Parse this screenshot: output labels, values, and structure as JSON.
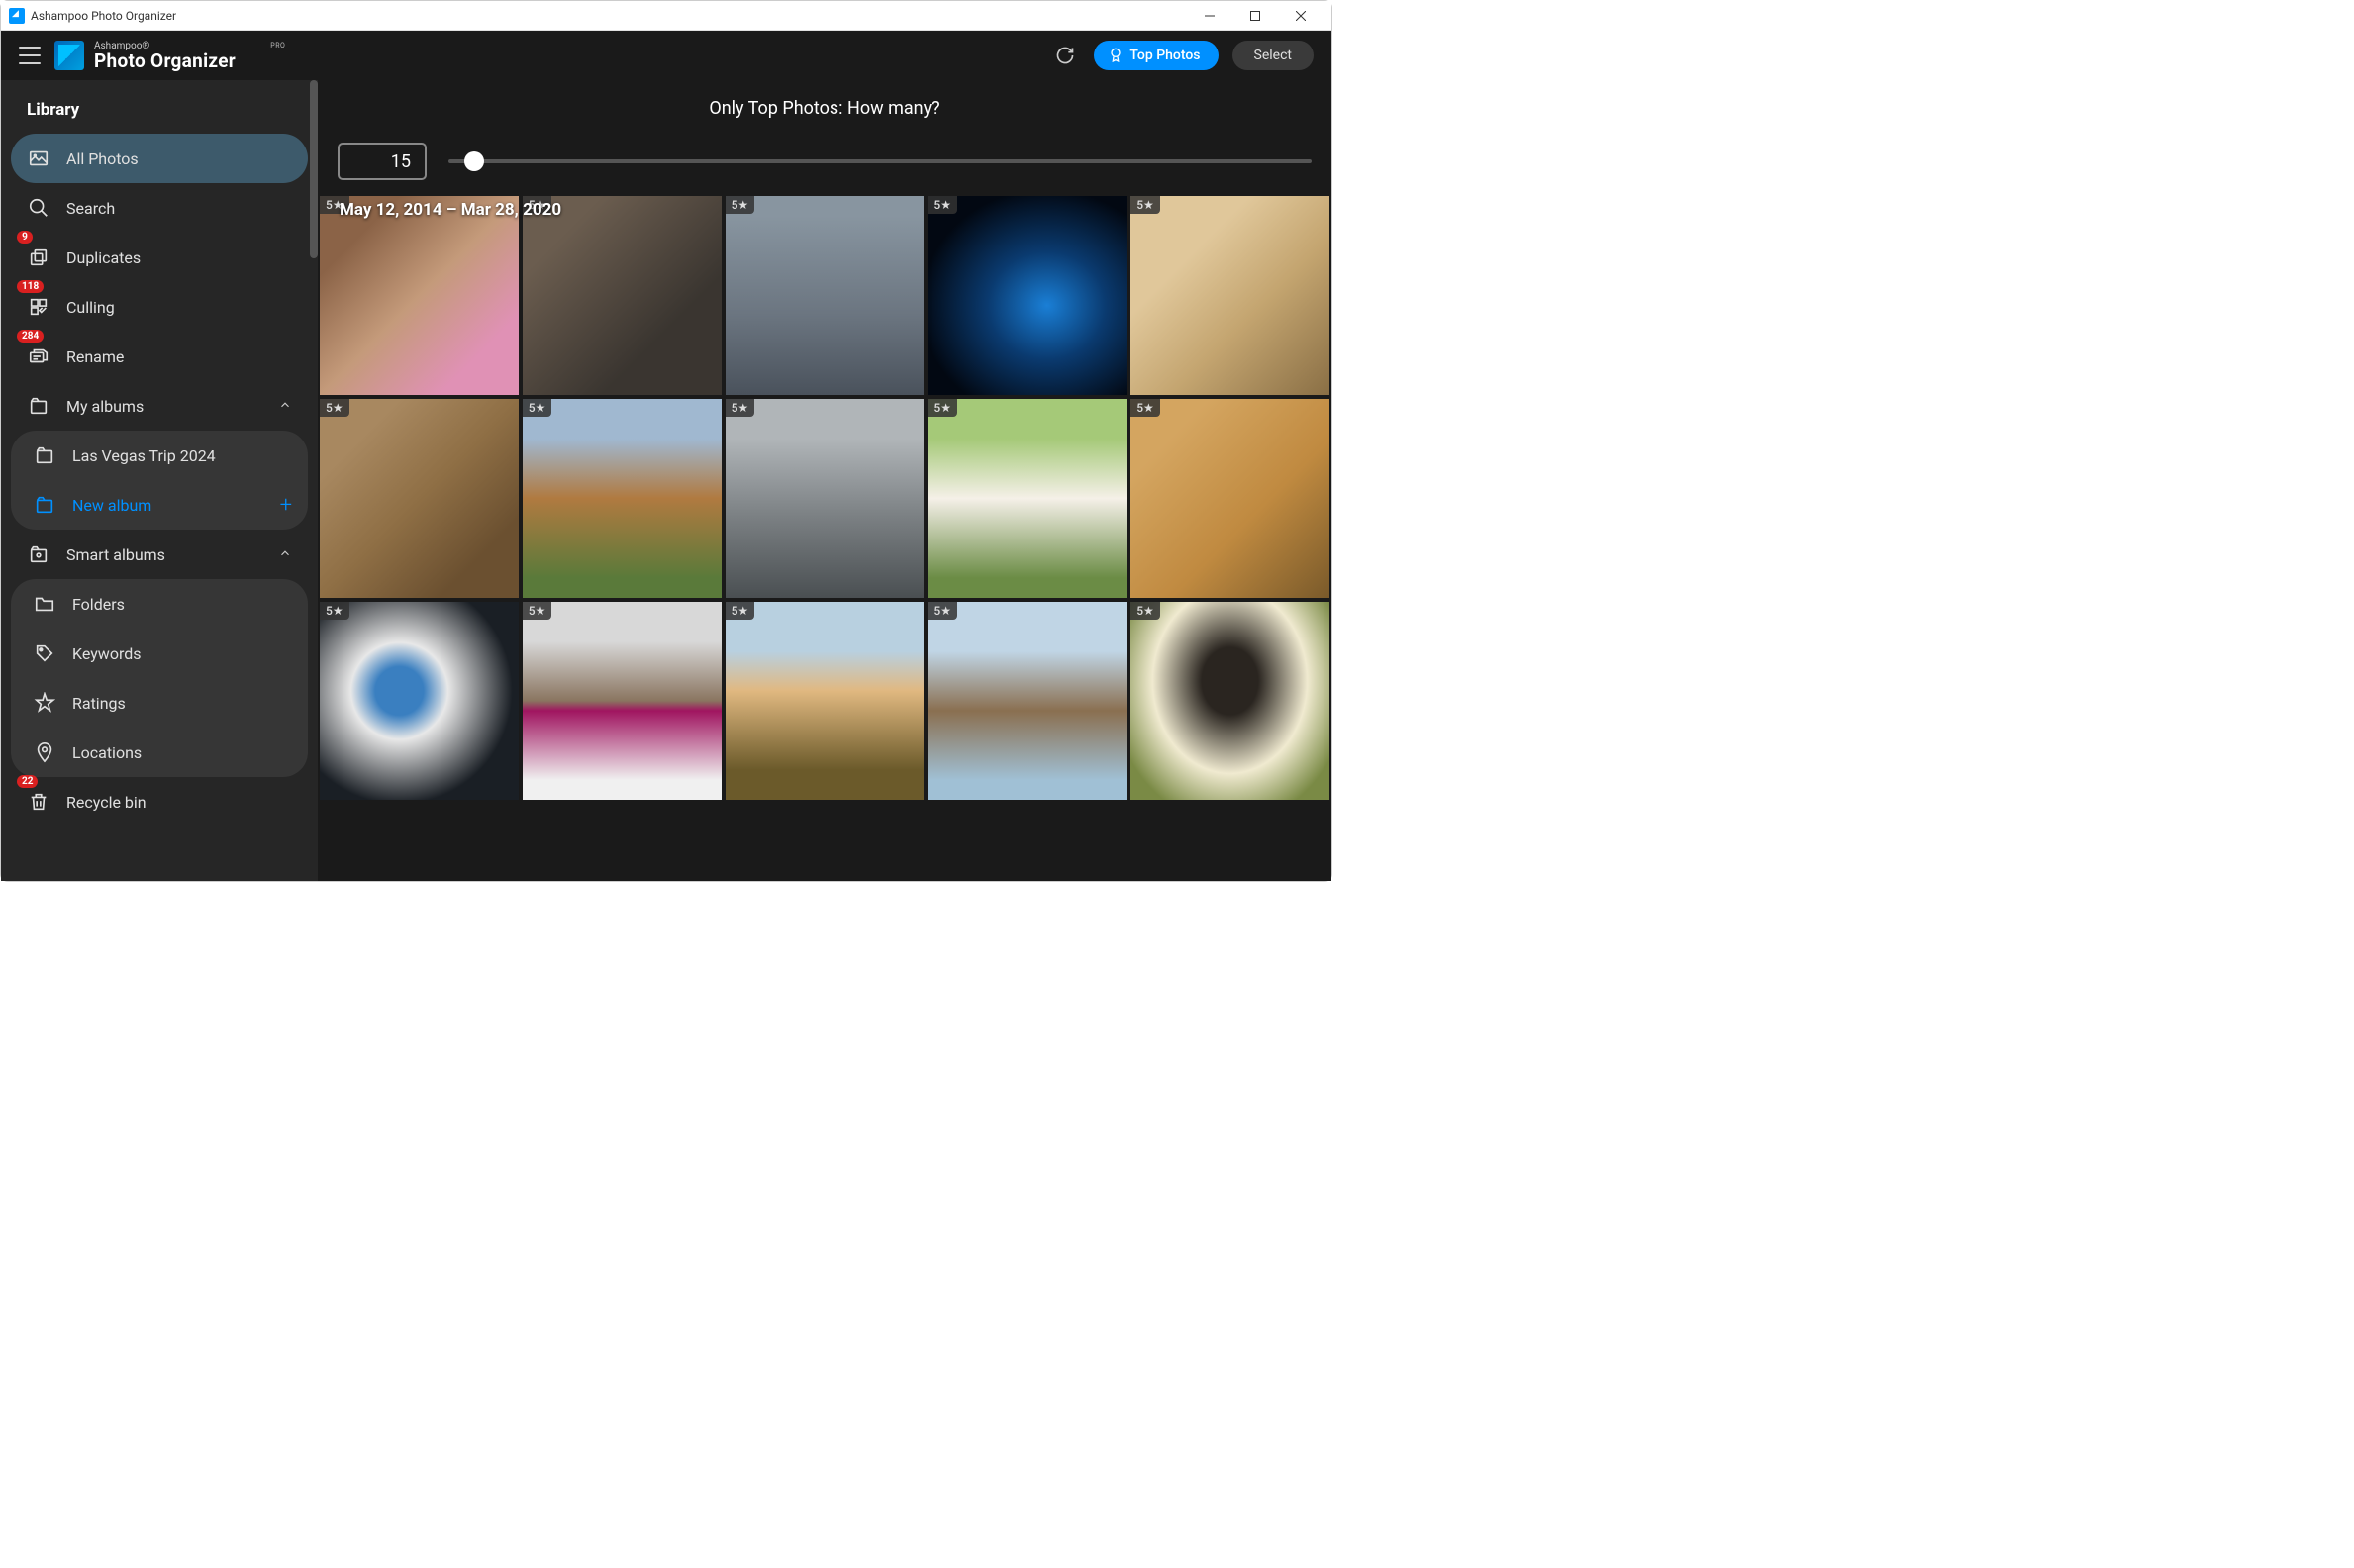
{
  "window": {
    "title": "Ashampoo Photo Organizer"
  },
  "header": {
    "brand_line": "Ashampoo®",
    "product": "Photo Organizer",
    "edition": "PRO",
    "top_photos": "Top Photos",
    "select": "Select"
  },
  "sidebar": {
    "heading": "Library",
    "all_photos": "All Photos",
    "search": "Search",
    "duplicates": {
      "label": "Duplicates",
      "badge": "9"
    },
    "culling": {
      "label": "Culling",
      "badge": "118"
    },
    "rename": {
      "label": "Rename",
      "badge": "284"
    },
    "my_albums": "My albums",
    "album_1": "Las Vegas Trip 2024",
    "new_album": "New album",
    "smart_albums": "Smart albums",
    "folders": "Folders",
    "keywords": "Keywords",
    "ratings": "Ratings",
    "locations": "Locations",
    "recycle": {
      "label": "Recycle bin",
      "badge": "22"
    }
  },
  "filter": {
    "title": "Only Top Photos: How many?",
    "count": "15"
  },
  "date_range": "May 12, 2014 – Mar 28, 2020",
  "thumbs": [
    {
      "rating": "5★"
    },
    {
      "rating": "5★"
    },
    {
      "rating": "5★"
    },
    {
      "rating": "5★"
    },
    {
      "rating": "5★"
    },
    {
      "rating": "5★"
    },
    {
      "rating": "5★"
    },
    {
      "rating": "5★"
    },
    {
      "rating": "5★"
    },
    {
      "rating": "5★"
    },
    {
      "rating": "5★"
    },
    {
      "rating": "5★"
    },
    {
      "rating": "5★"
    },
    {
      "rating": "5★"
    },
    {
      "rating": "5★"
    }
  ]
}
